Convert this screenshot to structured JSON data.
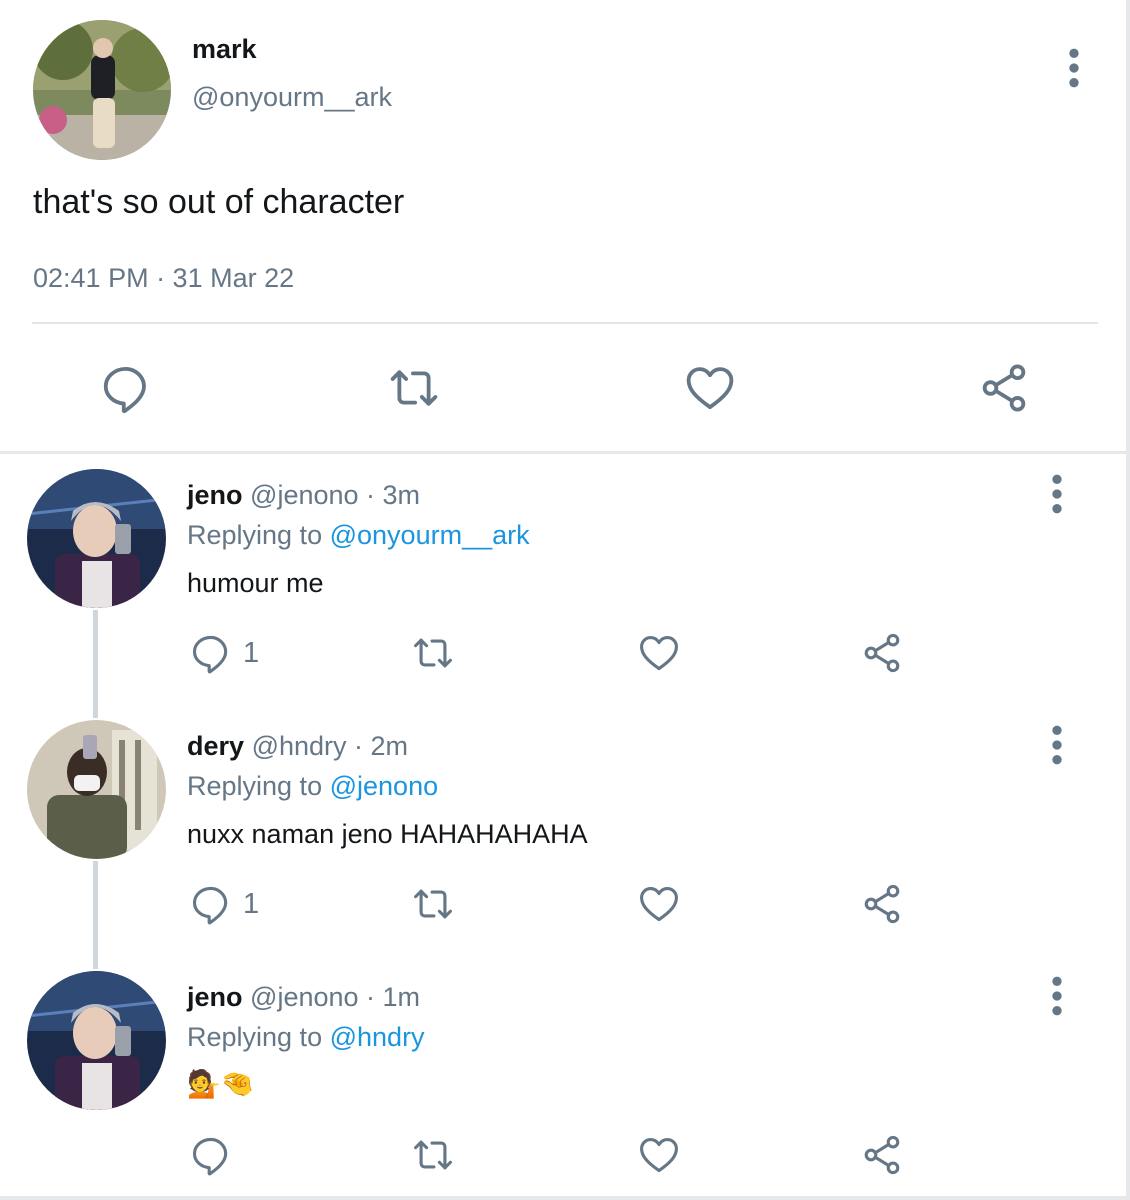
{
  "main_tweet": {
    "name": "mark",
    "handle": "@onyourm__ark",
    "text": "that's so out of character",
    "timestamp": "02:41 PM · 31 Mar 22",
    "avatar_icon": "profile-photo",
    "more_icon": "vertical-dots-icon",
    "actions": [
      "reply-icon",
      "retweet-icon",
      "like-icon",
      "share-icon"
    ]
  },
  "replies": [
    {
      "name": "jeno",
      "handle": "@jenono",
      "time": "· 3m",
      "replying_prefix": "Replying to",
      "replying_to": "@onyourm__ark",
      "text": "humour me",
      "reply_count": "1"
    },
    {
      "name": "dery",
      "handle": "@hndry",
      "time": "· 2m",
      "replying_prefix": "Replying to",
      "replying_to": "@jenono",
      "text": "nuxx naman jeno HAHAHAHAHA",
      "reply_count": "1"
    },
    {
      "name": "jeno",
      "handle": "@jenono",
      "time": "· 1m",
      "replying_prefix": "Replying to",
      "replying_to": "@hndry",
      "text": "💁🤏",
      "reply_count": ""
    }
  ],
  "colors": {
    "text_primary": "#14171a",
    "text_secondary": "#657786",
    "mention": "#1b95e0",
    "icon": "#657786",
    "divider": "#e3e6ea",
    "thread_line": "#cfd6dc"
  }
}
